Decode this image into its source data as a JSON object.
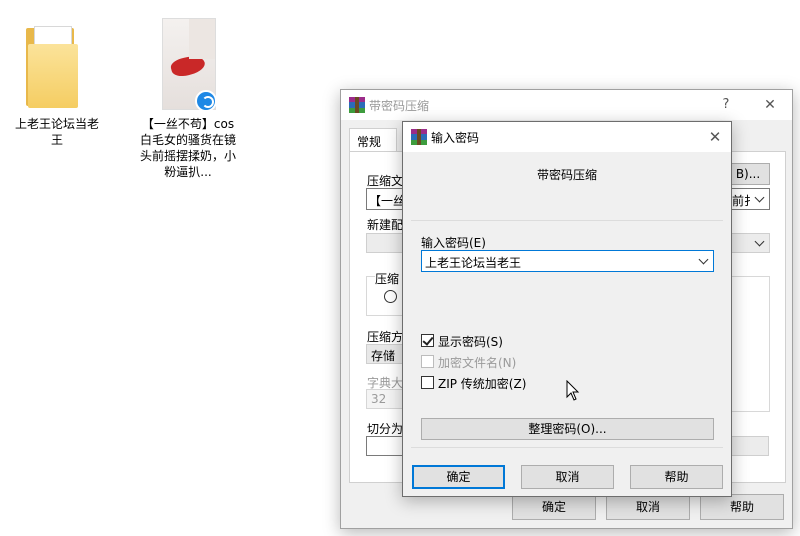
{
  "desktop": {
    "folder_label": "上老王论坛当老王",
    "video_label": "【一丝不苟】cos白毛女的骚货在镜头前摇摆揉奶，小粉逼扒..."
  },
  "back_window": {
    "title": "带密码压缩",
    "help_glyph": "?",
    "close_glyph": "✕",
    "tab_general": "常规",
    "archive_name_label": "压缩文",
    "archive_name_value": "【一丝",
    "browse_btn": "B)...",
    "update_mode_partial": "前扌",
    "new_profile_label": "新建配",
    "format_group_label": "压缩",
    "method_label": "压缩方",
    "method_value": "存储",
    "dict_label": "字典大",
    "dict_value": "32",
    "split_label": "切分为",
    "ok": "确定",
    "cancel": "取消",
    "help": "帮助"
  },
  "dialog": {
    "title": "输入密码",
    "close_glyph": "✕",
    "heading": "带密码压缩",
    "password_label": "输入密码(E)",
    "password_value": "上老王论坛当老王",
    "show_password": "显示密码(S)",
    "encrypt_filenames": "加密文件名(N)",
    "zip_legacy": "ZIP 传统加密(Z)",
    "organize_btn": "整理密码(O)...",
    "ok": "确定",
    "cancel": "取消",
    "help": "帮助",
    "show_password_checked": true,
    "encrypt_filenames_checked": false,
    "zip_legacy_checked": false
  },
  "colors": {
    "accent": "#0078d7",
    "folder": "#f5cd62"
  }
}
